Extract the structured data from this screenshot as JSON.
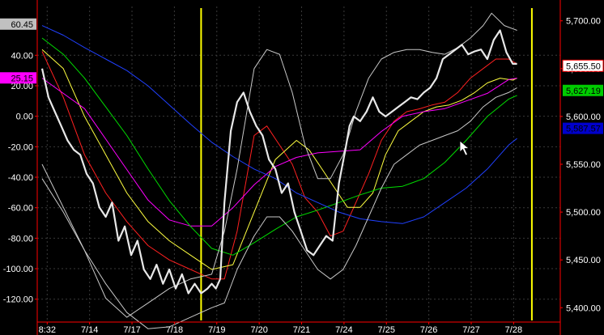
{
  "chart_data": {
    "type": "line",
    "title": "",
    "xlabel": "",
    "ylabel": "",
    "grid": true,
    "background": "#000000",
    "x_ticks": [
      "8:32",
      "7/14",
      "7/17",
      "7/18",
      "7/19",
      "7/20",
      "7/21",
      "7/24",
      "7/25",
      "7/26",
      "7/27",
      "7/28"
    ],
    "x_range": [
      0,
      11.8
    ],
    "left_axis": {
      "ticks": [
        40,
        20,
        0,
        -20,
        -40,
        -60,
        -80,
        -100,
        -120
      ],
      "tick_labels": [
        "40.00",
        "20.00",
        "0.00",
        "-20.00",
        "-40.00",
        "-60.00",
        "-80.00",
        "-100.00",
        "-120.00"
      ],
      "range": [
        -135,
        72
      ],
      "badges": [
        {
          "label": "60.45",
          "value": 60.45,
          "bg": "#c0c0c0",
          "fg": "#000000"
        },
        {
          "label": "25.15",
          "value": 25.15,
          "bg": "#ff00ff",
          "fg": "#000000"
        }
      ]
    },
    "right_axis": {
      "ticks": [
        5700,
        5650,
        5600,
        5550,
        5500,
        5450,
        5400
      ],
      "tick_labels": [
        "5,700.00",
        "5,650.00",
        "5,600.00",
        "5,550.00",
        "5,500.00",
        "5,450.00",
        "5,400.00"
      ],
      "range": [
        5385,
        5715
      ],
      "badges": [
        {
          "label": "5,655.50",
          "value": 5653,
          "bg": "#ffffff",
          "fg": "#000000",
          "border": "#ff0000"
        },
        {
          "label": "5,627.19",
          "value": 5627.19,
          "bg": "#00cc00",
          "fg": "#000000"
        },
        {
          "label": "5,587.57",
          "value": 5587.57,
          "bg": "#0000cc",
          "fg": "#000000"
        }
      ]
    },
    "vertical_markers": [
      {
        "x": 3.75,
        "color": "#ffff00"
      },
      {
        "x": 11.55,
        "color": "#ffff00"
      }
    ],
    "series": [
      {
        "axis": "right",
        "color": "#e8e8e8",
        "width": 2.2,
        "x": [
          0,
          0.15,
          0.3,
          0.45,
          0.6,
          0.75,
          0.9,
          1.05,
          1.2,
          1.35,
          1.5,
          1.65,
          1.8,
          1.95,
          2.1,
          2.25,
          2.4,
          2.55,
          2.7,
          2.85,
          3.0,
          3.15,
          3.3,
          3.45,
          3.6,
          3.75,
          3.9,
          4.0,
          4.1,
          4.2,
          4.3,
          4.45,
          4.6,
          4.75,
          4.9,
          5.05,
          5.2,
          5.35,
          5.5,
          5.65,
          5.8,
          5.95,
          6.1,
          6.25,
          6.4,
          6.55,
          6.7,
          6.85,
          7.0,
          7.15,
          7.25,
          7.35,
          7.5,
          7.65,
          7.8,
          7.95,
          8.1,
          8.25,
          8.4,
          8.55,
          8.7,
          8.85,
          9.0,
          9.15,
          9.3,
          9.45,
          9.6,
          9.75,
          9.9,
          10.05,
          10.2,
          10.35,
          10.5,
          10.65,
          10.8,
          10.95,
          11.1,
          11.2
        ],
        "y": [
          5650,
          5620,
          5605,
          5590,
          5575,
          5565,
          5560,
          5540,
          5530,
          5505,
          5495,
          5510,
          5470,
          5485,
          5455,
          5470,
          5440,
          5430,
          5445,
          5425,
          5440,
          5420,
          5435,
          5415,
          5425,
          5415,
          5420,
          5425,
          5420,
          5430,
          5510,
          5585,
          5615,
          5625,
          5605,
          5590,
          5580,
          5555,
          5545,
          5520,
          5530,
          5500,
          5480,
          5460,
          5455,
          5465,
          5475,
          5470,
          5530,
          5565,
          5590,
          5600,
          5595,
          5605,
          5620,
          5605,
          5600,
          5605,
          5610,
          5615,
          5620,
          5618,
          5625,
          5630,
          5640,
          5660,
          5665,
          5670,
          5675,
          5665,
          5668,
          5670,
          5660,
          5680,
          5690,
          5667,
          5655,
          5655
        ]
      },
      {
        "axis": "right",
        "color": "#ff2020",
        "width": 1,
        "x": [
          0,
          0.5,
          1,
          1.5,
          2,
          2.5,
          3,
          3.5,
          4,
          4.3,
          4.6,
          5,
          5.3,
          5.6,
          5.9,
          6.2,
          6.5,
          6.8,
          7.1,
          7.4,
          7.7,
          8,
          8.3,
          8.6,
          8.9,
          9.2,
          9.5,
          9.8,
          10.1,
          10.4,
          10.7,
          11,
          11.2
        ],
        "y": [
          5668,
          5620,
          5560,
          5520,
          5490,
          5465,
          5450,
          5440,
          5430,
          5430,
          5480,
          5580,
          5590,
          5570,
          5550,
          5515,
          5500,
          5475,
          5480,
          5510,
          5540,
          5575,
          5595,
          5605,
          5608,
          5612,
          5615,
          5625,
          5640,
          5650,
          5660,
          5660,
          5655
        ]
      },
      {
        "axis": "right",
        "color": "#ffff40",
        "width": 1,
        "x": [
          0,
          0.5,
          1,
          1.5,
          2,
          2.5,
          3,
          3.5,
          4,
          4.5,
          5,
          5.5,
          6,
          6.3,
          6.6,
          6.9,
          7.2,
          7.5,
          7.8,
          8.1,
          8.4,
          8.7,
          9,
          9.3,
          9.6,
          9.9,
          10.2,
          10.5,
          10.8,
          11.1,
          11.2
        ],
        "y": [
          5670,
          5650,
          5600,
          5560,
          5520,
          5490,
          5470,
          5455,
          5440,
          5445,
          5500,
          5555,
          5575,
          5565,
          5545,
          5525,
          5505,
          5505,
          5520,
          5560,
          5585,
          5595,
          5605,
          5610,
          5612,
          5617,
          5625,
          5635,
          5640,
          5638,
          5640
        ]
      },
      {
        "axis": "left",
        "color": "#ff00ff",
        "width": 1,
        "x": [
          0,
          0.5,
          1,
          1.5,
          2,
          2.5,
          3,
          3.5,
          4,
          4.5,
          5,
          5.5,
          6,
          6.5,
          7,
          7.5,
          8,
          8.5,
          9,
          9.5,
          10,
          10.5,
          11,
          11.2
        ],
        "y": [
          25,
          15,
          5,
          -15,
          -35,
          -55,
          -68,
          -72,
          -72,
          -60,
          -45,
          -33,
          -27,
          -24,
          -23,
          -22,
          -10,
          0,
          3,
          5,
          10,
          15,
          24,
          25
        ]
      },
      {
        "axis": "right",
        "color": "#00dd00",
        "width": 1,
        "x": [
          0,
          0.5,
          1,
          1.5,
          2,
          2.5,
          3,
          3.5,
          4,
          4.5,
          5,
          5.5,
          6,
          6.5,
          7,
          7.5,
          8,
          8.5,
          9,
          9.5,
          10,
          10.5,
          11,
          11.2
        ],
        "y": [
          5682,
          5665,
          5640,
          5610,
          5580,
          5545,
          5512,
          5485,
          5462,
          5455,
          5468,
          5482,
          5495,
          5502,
          5510,
          5518,
          5525,
          5527,
          5535,
          5552,
          5575,
          5600,
          5618,
          5622
        ]
      },
      {
        "axis": "right",
        "color": "#2040ff",
        "width": 1,
        "x": [
          0,
          0.5,
          1,
          1.5,
          2,
          2.5,
          3,
          3.5,
          4,
          4.5,
          5,
          5.5,
          6,
          6.5,
          7,
          7.5,
          8,
          8.5,
          9,
          9.5,
          10,
          10.5,
          11,
          11.2
        ],
        "y": [
          5695,
          5685,
          5672,
          5660,
          5648,
          5632,
          5612,
          5592,
          5573,
          5558,
          5545,
          5535,
          5520,
          5510,
          5500,
          5493,
          5490,
          5488,
          5495,
          5510,
          5525,
          5545,
          5570,
          5577
        ]
      },
      {
        "axis": "right",
        "color": "#c8c8c8",
        "width": 1,
        "x": [
          0,
          0.5,
          1,
          1.5,
          2,
          2.5,
          3,
          3.5,
          4,
          4.3,
          4.6,
          5,
          5.3,
          5.6,
          5.9,
          6.2,
          6.5,
          6.8,
          7.1,
          7.4,
          7.7,
          8,
          8.3,
          8.6,
          8.9,
          9.2,
          9.5,
          9.8,
          10.1,
          10.4,
          10.6,
          10.9,
          11.2
        ],
        "y": [
          5550,
          5505,
          5460,
          5410,
          5390,
          5405,
          5420,
          5430,
          5435,
          5480,
          5545,
          5650,
          5670,
          5665,
          5625,
          5570,
          5535,
          5535,
          5560,
          5605,
          5640,
          5660,
          5667,
          5670,
          5670,
          5667,
          5665,
          5672,
          5682,
          5695,
          5708,
          5695,
          5690
        ]
      },
      {
        "axis": "right",
        "color": "#c8c8c8",
        "width": 1,
        "x": [
          0,
          0.5,
          1,
          1.5,
          2,
          2.5,
          3,
          3.5,
          4,
          4.3,
          4.6,
          5,
          5.3,
          5.6,
          5.9,
          6.2,
          6.5,
          6.8,
          7.1,
          7.4,
          7.7,
          8,
          8.3,
          8.6,
          8.9,
          9.2,
          9.5,
          9.8,
          10.1,
          10.4,
          10.7,
          11.0,
          11.2
        ],
        "y": [
          5535,
          5500,
          5460,
          5425,
          5395,
          5378,
          5380,
          5390,
          5400,
          5405,
          5440,
          5475,
          5495,
          5495,
          5480,
          5460,
          5440,
          5430,
          5440,
          5465,
          5495,
          5525,
          5550,
          5560,
          5570,
          5575,
          5580,
          5585,
          5595,
          5610,
          5620,
          5625,
          5630
        ]
      }
    ]
  }
}
